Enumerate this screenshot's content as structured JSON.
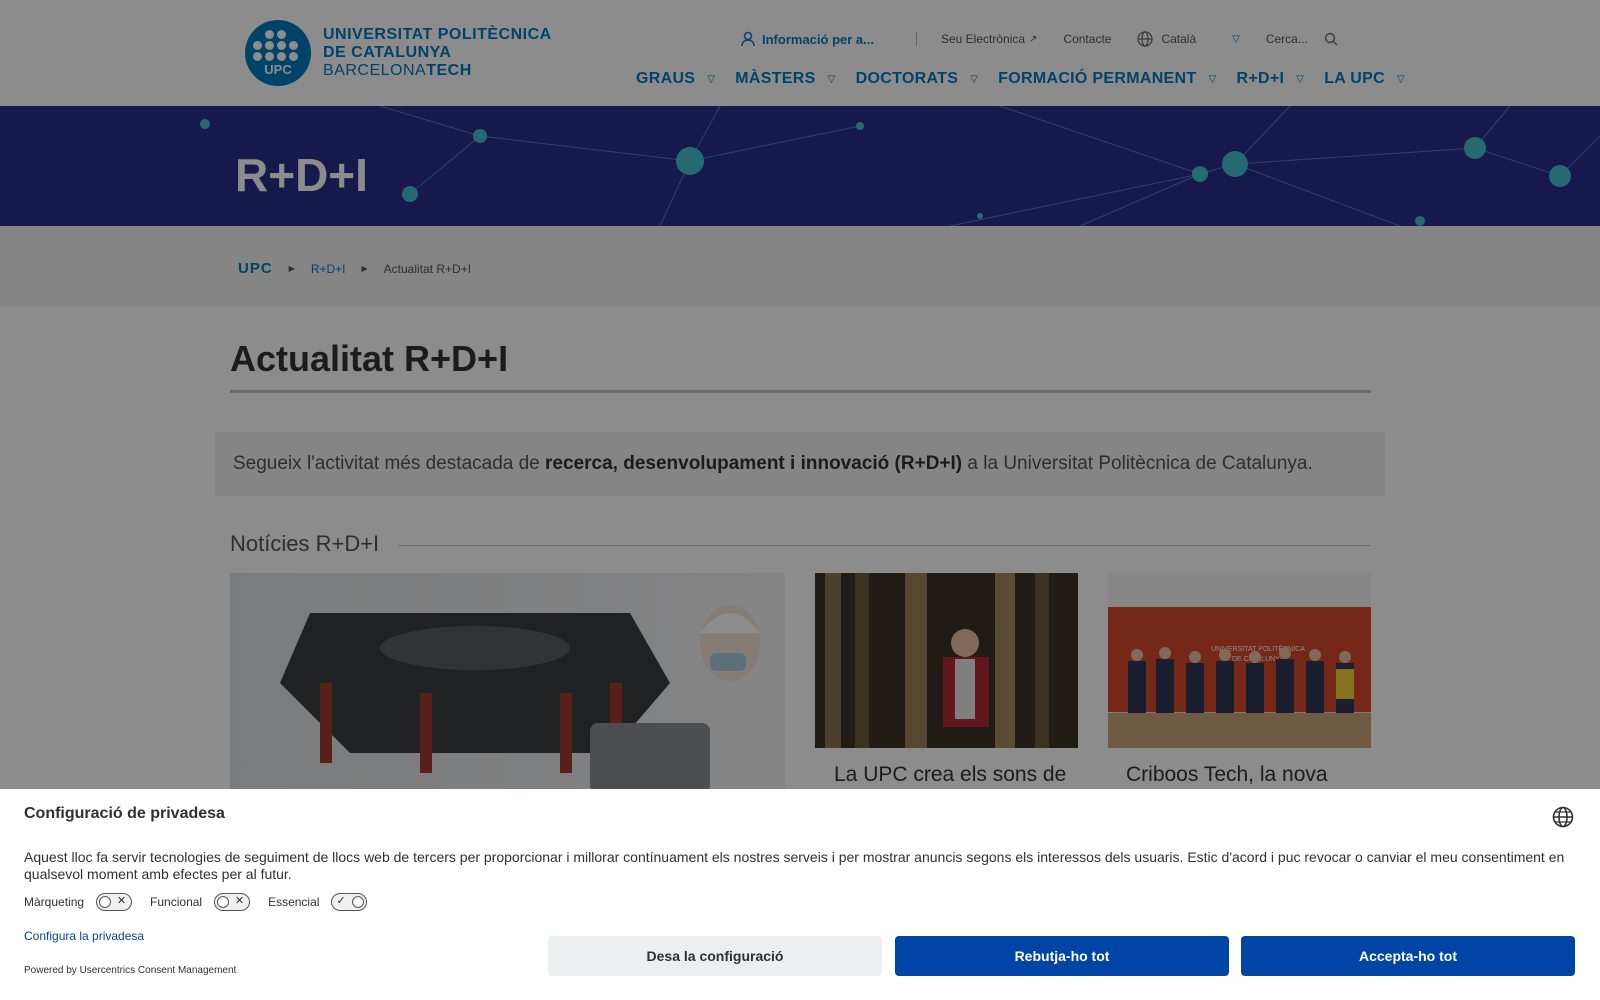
{
  "header": {
    "logo": {
      "badge": "UPC",
      "line1": "UNIVERSITAT POLITÈCNICA",
      "line2": "DE CATALUNYA",
      "line3a": "BARCELONA",
      "line3b": "TECH"
    },
    "topbar": {
      "info": "Informació per a...",
      "seu": "Seu Electrònica",
      "contact": "Contacte",
      "language": "Català",
      "search_placeholder": "Cerca..."
    },
    "nav": [
      "GRAUS",
      "MÀSTERS",
      "DOCTORATS",
      "FORMACIÓ PERMANENT",
      "R+D+I",
      "LA UPC"
    ]
  },
  "banner": {
    "title": "R+D+I"
  },
  "breadcrumb": {
    "home": "UPC",
    "level1": "R+D+I",
    "current": "Actualitat R+D+I"
  },
  "content": {
    "title": "Actualitat R+D+I",
    "intro_pre": "Segueix l'activitat més destacada de ",
    "intro_bold": "recerca, desenvolupament i innovació (R+D+I)",
    "intro_post": " a la Universitat Politècnica de Catalunya.",
    "section": "Notícies R+D+I",
    "cards": [
      {
        "title": ""
      },
      {
        "title": "La UPC crea els sons de"
      },
      {
        "title": "Criboos Tech, la nova"
      }
    ]
  },
  "consent": {
    "title": "Configuració de privadesa",
    "text": "Aquest lloc fa servir tecnologies de seguiment de llocs web de tercers per proporcionar i millorar contínuament els nostres serveis i per mostrar anuncis segons els interessos dels usuaris. Estic d'acord i puc revocar o canviar el meu consentiment en qualsevol moment amb efectes per al futur.",
    "toggles": [
      {
        "label": "Màrqueting",
        "on": false
      },
      {
        "label": "Funcional",
        "on": false
      },
      {
        "label": "Essencial",
        "on": true
      }
    ],
    "configure": "Configura la privadesa",
    "powered": "Powered by Usercentrics Consent Management",
    "save": "Desa la configuració",
    "deny": "Rebutja-ho tot",
    "accept": "Accepta-ho tot"
  },
  "colors": {
    "brand": "#007bc0",
    "banner": "#2a2f8a",
    "consent_button": "#0045a5"
  }
}
